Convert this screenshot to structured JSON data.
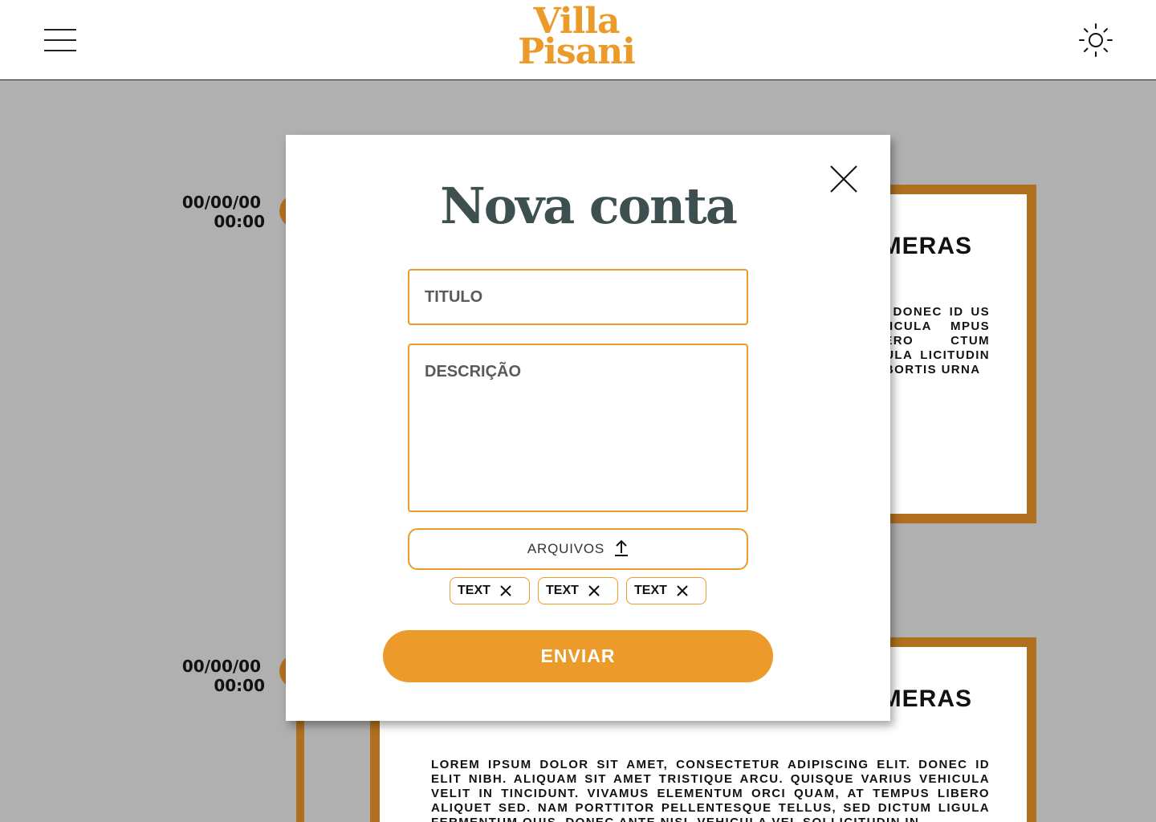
{
  "header": {
    "logo_line1": "Villa",
    "logo_line2": "Pisani",
    "menu_icon": "hamburger-menu-icon",
    "theme_icon": "sun-icon"
  },
  "timeline": [
    {
      "date": "00/00/00",
      "time": "00:00",
      "title_visible": "MERAS",
      "text_visible": "LIT. DONEC ID US VEHICULA MPUS LIBERO CTUM LIGULA LICITUDIN IN, BORTIS URNA"
    },
    {
      "date": "00/00/00",
      "time": "00:00",
      "title_visible": "MERAS",
      "text_visible": "LOREM IPSUM DOLOR SIT AMET, CONSECTETUR ADIPISCING ELIT. DONEC ID ELIT NIBH. ALIQUAM SIT AMET TRISTIQUE ARCU. QUISQUE VARIUS VEHICULA VELIT IN TINCIDUNT. VIVAMUS ELEMENTUM ORCI QUAM, AT TEMPUS LIBERO ALIQUET SED. NAM PORTTITOR PELLENTESQUE TELLUS, SED DICTUM LIGULA FERMENTUM QUIS. DONEC ANTE NISI, VEHICULA VEL SOLLICITUDIN IN,"
    }
  ],
  "modal": {
    "title": "Nova conta",
    "title_placeholder": "TITULO",
    "description_placeholder": "DESCRIÇÃO",
    "upload_label": "ARQUIVOS",
    "upload_icon": "upload-arrow-icon",
    "close_icon": "close-icon",
    "chips": [
      {
        "label": "TEXT"
      },
      {
        "label": "TEXT"
      },
      {
        "label": "TEXT"
      }
    ],
    "submit_label": "ENVIAR"
  },
  "colors": {
    "accent": "#ec9a29",
    "timeline_accent": "#b0701f",
    "title": "#3e4f50",
    "overlay": "#b0b0b0"
  }
}
